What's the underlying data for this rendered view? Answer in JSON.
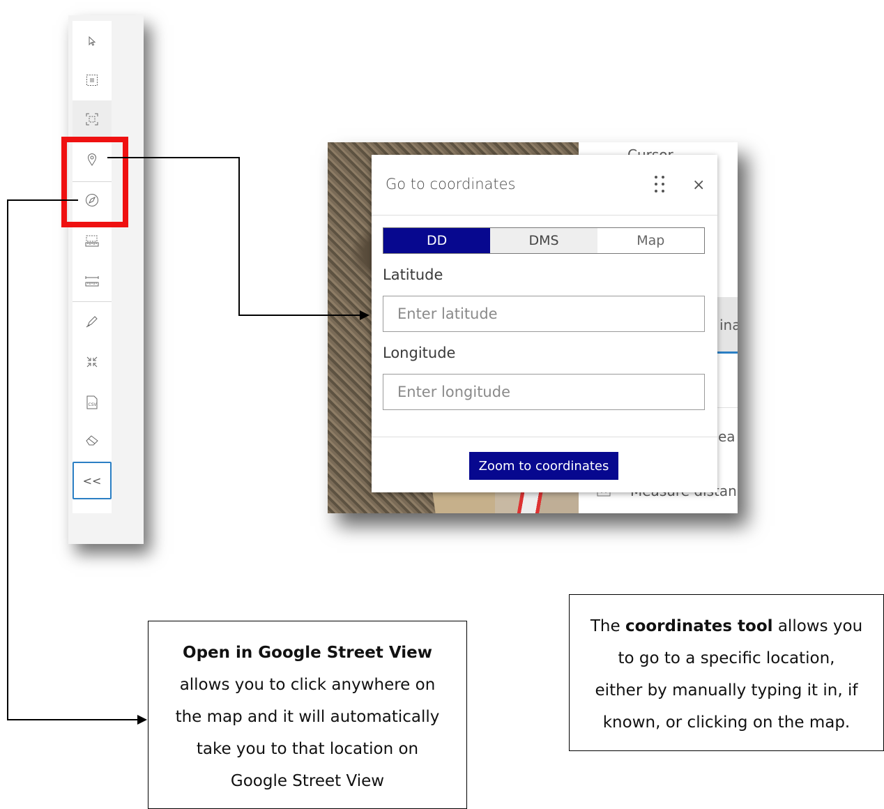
{
  "toolbar": {
    "tools": [
      {
        "name": "select-pointer",
        "icon": "cursor-icon"
      },
      {
        "name": "select-area",
        "icon": "select-rectangle-icon"
      },
      {
        "name": "extent",
        "icon": "selection-frame-icon"
      },
      {
        "name": "go-to-coordinates",
        "icon": "map-pin-icon"
      },
      {
        "name": "street-view",
        "icon": "compass-icon"
      },
      {
        "name": "measure-area",
        "icon": "measure-area-icon"
      },
      {
        "name": "measure-distance",
        "icon": "ruler-icon"
      },
      {
        "name": "draw",
        "icon": "pen-icon"
      },
      {
        "name": "zoom-extent",
        "icon": "collapse-arrows-icon"
      },
      {
        "name": "export-csv",
        "icon": "csv-file-icon"
      },
      {
        "name": "clear",
        "icon": "eraser-icon"
      }
    ],
    "collapse_label": "<<"
  },
  "behind_panel": {
    "cursor_fragment": "Cursor",
    "coordinates_fragment": "ina",
    "area_fragment": "ea",
    "distance_fragment": "Measure distan"
  },
  "dialog": {
    "title": "Go to coordinates",
    "close_glyph": "×",
    "segments": [
      "DD",
      "DMS",
      "Map"
    ],
    "selected_segment": "DD",
    "latitude_label": "Latitude",
    "latitude_placeholder": "Enter latitude",
    "longitude_label": "Longitude",
    "longitude_placeholder": "Enter longitude",
    "zoom_button": "Zoom to coordinates"
  },
  "callouts": {
    "street_view": {
      "title": "Open in Google Street View",
      "lines": [
        "allows you to click anywhere on",
        "the map and it will automatically",
        "take you to that location on",
        "Google Street View"
      ]
    },
    "coordinates": {
      "pre": "The ",
      "bold": "coordinates tool",
      "post": " allows you",
      "lines": [
        "to go to a specific location,",
        "either by manually typing it in, if",
        "known, or clicking on the map."
      ]
    }
  },
  "colors": {
    "accent_blue": "#07088f",
    "highlight_red": "#ef1111",
    "focus_blue": "#2b7fc4"
  }
}
